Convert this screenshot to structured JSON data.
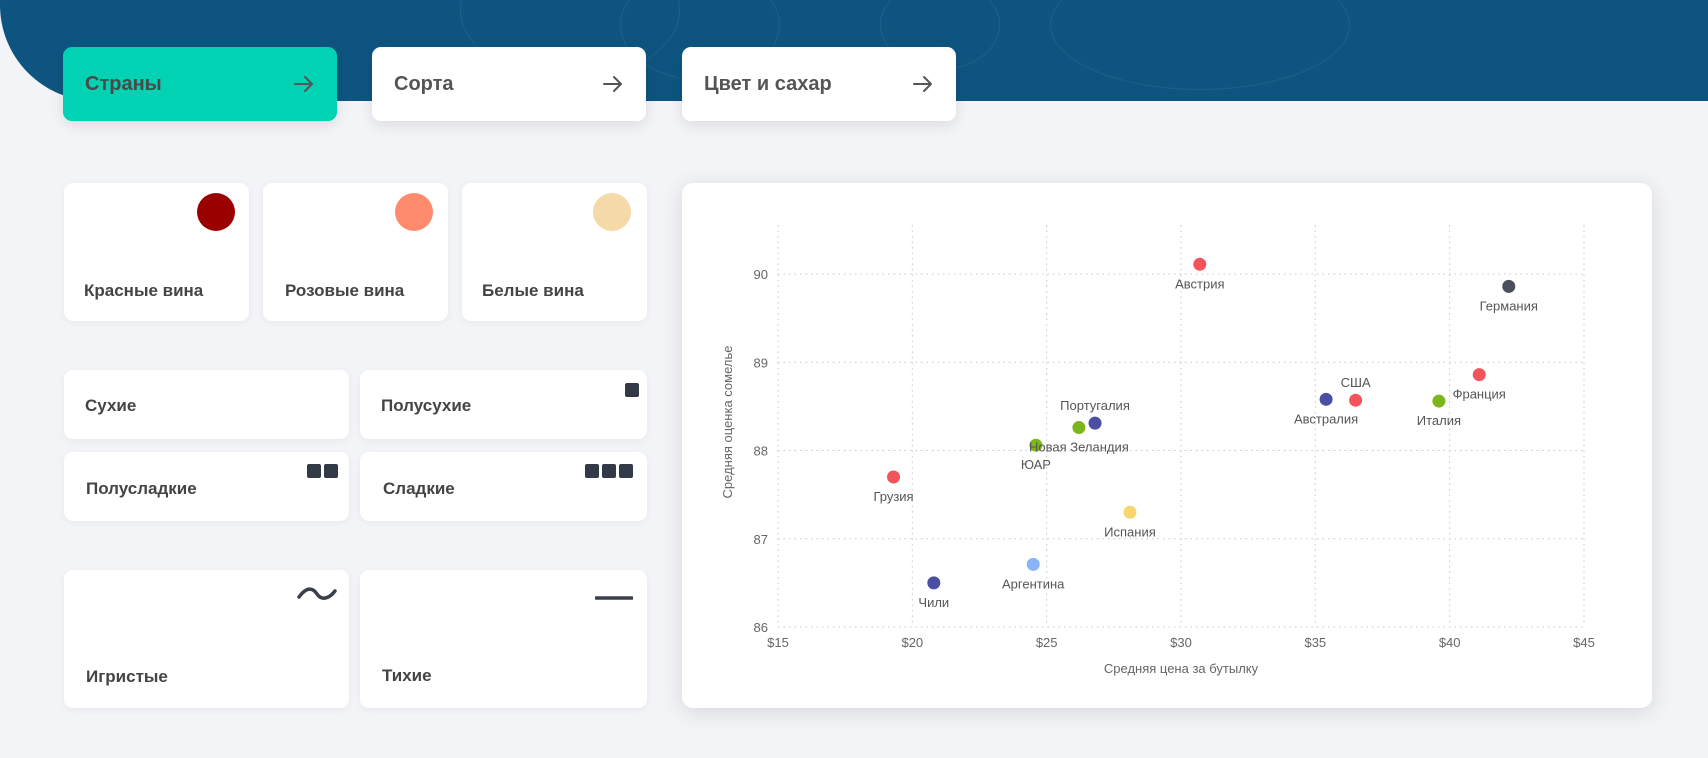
{
  "nav": {
    "tabs": [
      {
        "label": "Страны",
        "active": true
      },
      {
        "label": "Сорта",
        "active": false
      },
      {
        "label": "Цвет и сахар",
        "active": false
      }
    ],
    "arrow_icon": "arrow-right-icon"
  },
  "colors": {
    "header": "#0d5580",
    "accent": "#02d2b4",
    "red_wine": "#9a0000",
    "rose_wine": "#ff8a6e",
    "white_wine": "#f5d9a8"
  },
  "wine_colors": {
    "red": {
      "label": "Красные вина",
      "color": "#9a0000"
    },
    "rose": {
      "label": "Розовые вина",
      "color": "#ff8a6e"
    },
    "white": {
      "label": "Белые вина",
      "color": "#f5d9a8"
    }
  },
  "sweetness": {
    "dry": {
      "label": "Сухие"
    },
    "semi_dry": {
      "label": "Полусухие",
      "level": 1
    },
    "semi_sweet": {
      "label": "Полусладкие",
      "level": 2
    },
    "sweet": {
      "label": "Сладкие",
      "level": 3
    }
  },
  "style": {
    "sparkling": {
      "label": "Игристые",
      "icon": "wave-icon"
    },
    "still": {
      "label": "Тихие",
      "icon": "flat-line-icon"
    }
  },
  "chart_data": {
    "type": "scatter",
    "xlabel": "Средняя цена за бутылку",
    "ylabel": "Средняя оценка сомелье",
    "xlim": [
      15,
      45
    ],
    "ylim": [
      86,
      90.5
    ],
    "x_ticks": [
      "$15",
      "$20",
      "$25",
      "$30",
      "$35",
      "$40",
      "$45"
    ],
    "x_tick_values": [
      15,
      20,
      25,
      30,
      35,
      40,
      45
    ],
    "y_ticks": [
      "86",
      "87",
      "88",
      "89",
      "90"
    ],
    "y_tick_values": [
      86,
      87,
      88,
      89,
      90
    ],
    "grid": true,
    "points": [
      {
        "label": "Австрия",
        "x": 30.7,
        "y": 90.11,
        "color": "#f2545b",
        "label_pos": "below"
      },
      {
        "label": "Германия",
        "x": 42.2,
        "y": 89.86,
        "color": "#4b4f5c",
        "label_pos": "below"
      },
      {
        "label": "Франция",
        "x": 41.1,
        "y": 88.86,
        "color": "#f2545b",
        "label_pos": "below"
      },
      {
        "label": "США",
        "x": 36.5,
        "y": 88.57,
        "color": "#f2545b",
        "label_pos": "above"
      },
      {
        "label": "Австралия",
        "x": 35.4,
        "y": 88.58,
        "color": "#4a4fa3",
        "label_pos": "below"
      },
      {
        "label": "Италия",
        "x": 39.6,
        "y": 88.56,
        "color": "#7bb61d",
        "label_pos": "below"
      },
      {
        "label": "Португалия",
        "x": 26.8,
        "y": 88.31,
        "color": "#4a4fa3",
        "label_pos": "above"
      },
      {
        "label": "Новая Зеландия",
        "x": 26.2,
        "y": 88.26,
        "color": "#7bb61d",
        "label_pos": "below"
      },
      {
        "label": "ЮАР",
        "x": 24.6,
        "y": 88.06,
        "color": "#7bb61d",
        "label_pos": "below"
      },
      {
        "label": "Грузия",
        "x": 19.3,
        "y": 87.7,
        "color": "#f2545b",
        "label_pos": "below"
      },
      {
        "label": "Испания",
        "x": 28.1,
        "y": 87.3,
        "color": "#f9d56e",
        "label_pos": "below"
      },
      {
        "label": "Аргентина",
        "x": 24.5,
        "y": 86.71,
        "color": "#8ab4f8",
        "label_pos": "below"
      },
      {
        "label": "Чили",
        "x": 20.8,
        "y": 86.5,
        "color": "#4a4fa3",
        "label_pos": "below"
      }
    ]
  }
}
